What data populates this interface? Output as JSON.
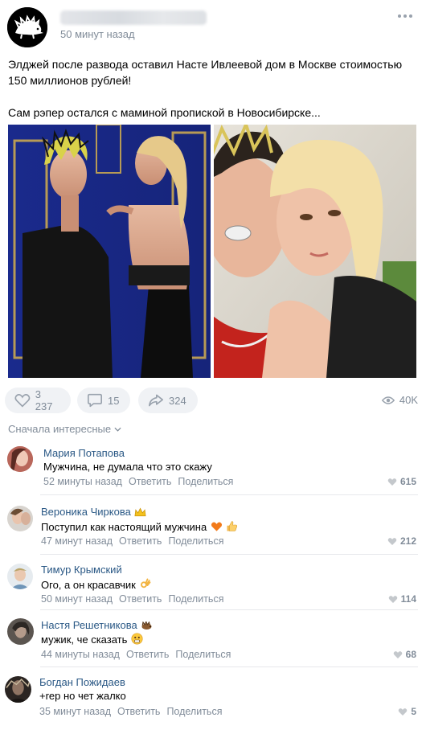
{
  "post": {
    "time": "50 минут назад",
    "text_line1": "Элджей после развода оставил Насте Ивлеевой дом в Москве стоимостью 150 миллионов рублей!",
    "text_line2": "Сам рэпер остался с маминой пропиской в Новосибирске...",
    "likes": "3 237",
    "comments": "15",
    "shares": "324",
    "views": "40K"
  },
  "comments_header": {
    "sort_label": "Сначала интересные"
  },
  "comments": [
    {
      "author": "Мария Потапова",
      "text": "Мужчина, не думала что это скажу",
      "time": "52 минуты назад",
      "reply": "Ответить",
      "share": "Поделиться",
      "likes": "615"
    },
    {
      "author": "Вероника Чиркова",
      "text": "Поступил как настоящий мужчина",
      "time": "47 минут назад",
      "reply": "Ответить",
      "share": "Поделиться",
      "likes": "212"
    },
    {
      "author": "Тимур Крымский",
      "text": "Ого, а он красавчик",
      "time": "50 минут назад",
      "reply": "Ответить",
      "share": "Поделиться",
      "likes": "114"
    },
    {
      "author": "Настя Решетникова",
      "text": "мужик, че сказать",
      "time": "44 минуты назад",
      "reply": "Ответить",
      "share": "Поделиться",
      "likes": "68"
    },
    {
      "author": "Богдан Пожидаев",
      "text": "+rep но чет жалко",
      "time": "35 минут назад",
      "reply": "Ответить",
      "share": "Поделиться",
      "likes": "5"
    }
  ],
  "colors": {
    "link": "#2a5885",
    "secondary": "#818c99",
    "button_bg": "#f0f2f5"
  }
}
